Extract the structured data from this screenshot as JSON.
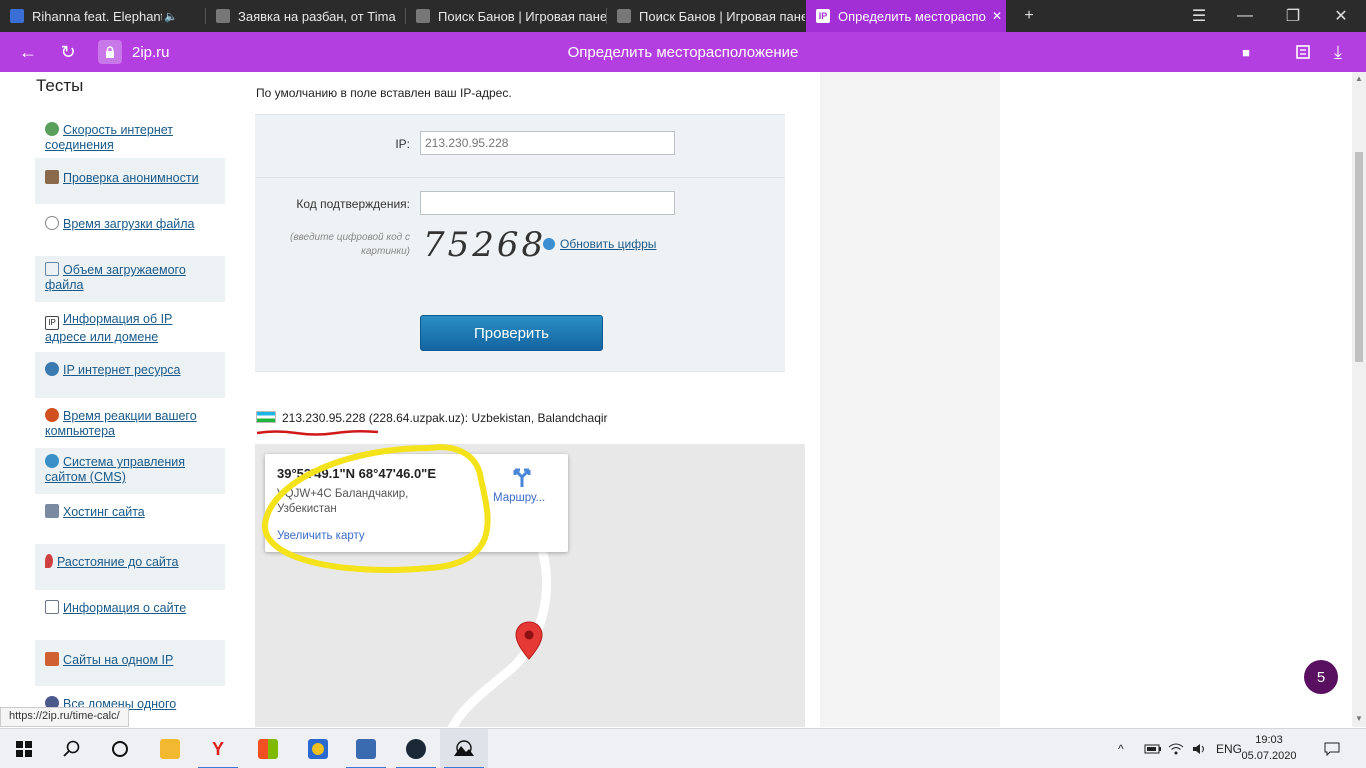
{
  "tabs": [
    {
      "label": "Rihanna feat. Elephant Man",
      "muted_icon": "🔈",
      "icon": "youtube-icon",
      "color": "#3b6fd6"
    },
    {
      "label": "Заявка на разбан, от Tima",
      "icon": "site-icon",
      "color": "#777777"
    },
    {
      "label": "Поиск Банов | Игровая панель",
      "icon": "site-icon",
      "color": "#777777"
    },
    {
      "label": "Поиск Банов | Игровая панель",
      "icon": "site-icon",
      "color": "#777777"
    },
    {
      "label": "Определить месторасположение",
      "icon": "2ip-icon",
      "color": "#ffffff"
    }
  ],
  "tab_close": "✕",
  "new_tab": "+",
  "window_controls": {
    "menu": "☰",
    "minimize": "—",
    "restore": "❐",
    "close": "✕"
  },
  "address_bar": {
    "domain": "2ip.ru",
    "page_title": "Определить месторасположение",
    "back": "←",
    "reload": "↻",
    "bookmark": "■",
    "download": "⤓"
  },
  "sidebar": {
    "title": "Тесты",
    "items": [
      {
        "label": "Скорость интернет соединения",
        "icon": "speed-icon",
        "color": "#5aa05a"
      },
      {
        "label": "Проверка анонимности",
        "icon": "anonymity-icon",
        "color": "#8a6a4a"
      },
      {
        "label": "Время загрузки файла",
        "icon": "clock-icon",
        "color": "#888888"
      },
      {
        "label": "Объем загружаемого файла",
        "icon": "file-size-icon",
        "color": "#6688aa"
      },
      {
        "label": "Информация об IP адресе или домене",
        "icon": "ip-icon",
        "color": "#444444"
      },
      {
        "label": "IP интернет ресурса",
        "icon": "ip-resource-icon",
        "color": "#3a7ab0"
      },
      {
        "label": "Время реакции вашего компьютера",
        "icon": "reaction-icon",
        "color": "#d05020"
      },
      {
        "label": "Система управления сайтом (CMS)",
        "icon": "cms-icon",
        "color": "#3a90c8"
      },
      {
        "label": "Хостинг сайта",
        "icon": "hosting-icon",
        "color": "#7a8aa0"
      },
      {
        "label": "Расстояние до сайта",
        "icon": "map-pin-icon",
        "color": "#d04040"
      },
      {
        "label": "Информация о сайте",
        "icon": "site-info-icon",
        "color": "#6a7a8a"
      },
      {
        "label": "Сайты на одном IP",
        "icon": "sites-one-ip-icon",
        "color": "#d06030"
      },
      {
        "label": "Все домены одного",
        "icon": "domains-icon",
        "color": "#4a5a8a"
      }
    ]
  },
  "form": {
    "default_note": "По умолчанию в поле вставлен ваш IP-адрес.",
    "ip_label": "IP:",
    "ip_value": "213.230.95.228",
    "code_label": "Код подтверждения:",
    "code_value": "",
    "hint": "(введите цифровой код с картинки)",
    "captcha": "75268",
    "refresh_label": "Обновить цифры",
    "submit_label": "Проверить"
  },
  "result": {
    "text": "213.230.95.228 (228.64.uzpak.uz): Uzbekistan, Balandchaqir",
    "flag": "uzbekistan-flag-icon"
  },
  "map": {
    "coords": "39°52'49.1\"N 68°47'46.0\"E",
    "plus_code": "VQJW+4C Баландчакир, Узбекистан",
    "enlarge": "Увеличить карту",
    "route": "Маршру...",
    "route_icon": "directions-icon",
    "pin_icon": "map-pin-icon"
  },
  "badge": "5",
  "status_url": "https://2ip.ru/time-calc/",
  "taskbar": {
    "tray": {
      "chevron": "^",
      "lang": "ENG"
    },
    "time": "19:03",
    "date": "05.07.2020",
    "colors": {
      "explorer": "#f2b830",
      "yandex": "#e02020",
      "store": "#2a6ad0",
      "app1": "#f0c020",
      "app2": "#3a6ab0",
      "steam": "#1b2838"
    }
  }
}
